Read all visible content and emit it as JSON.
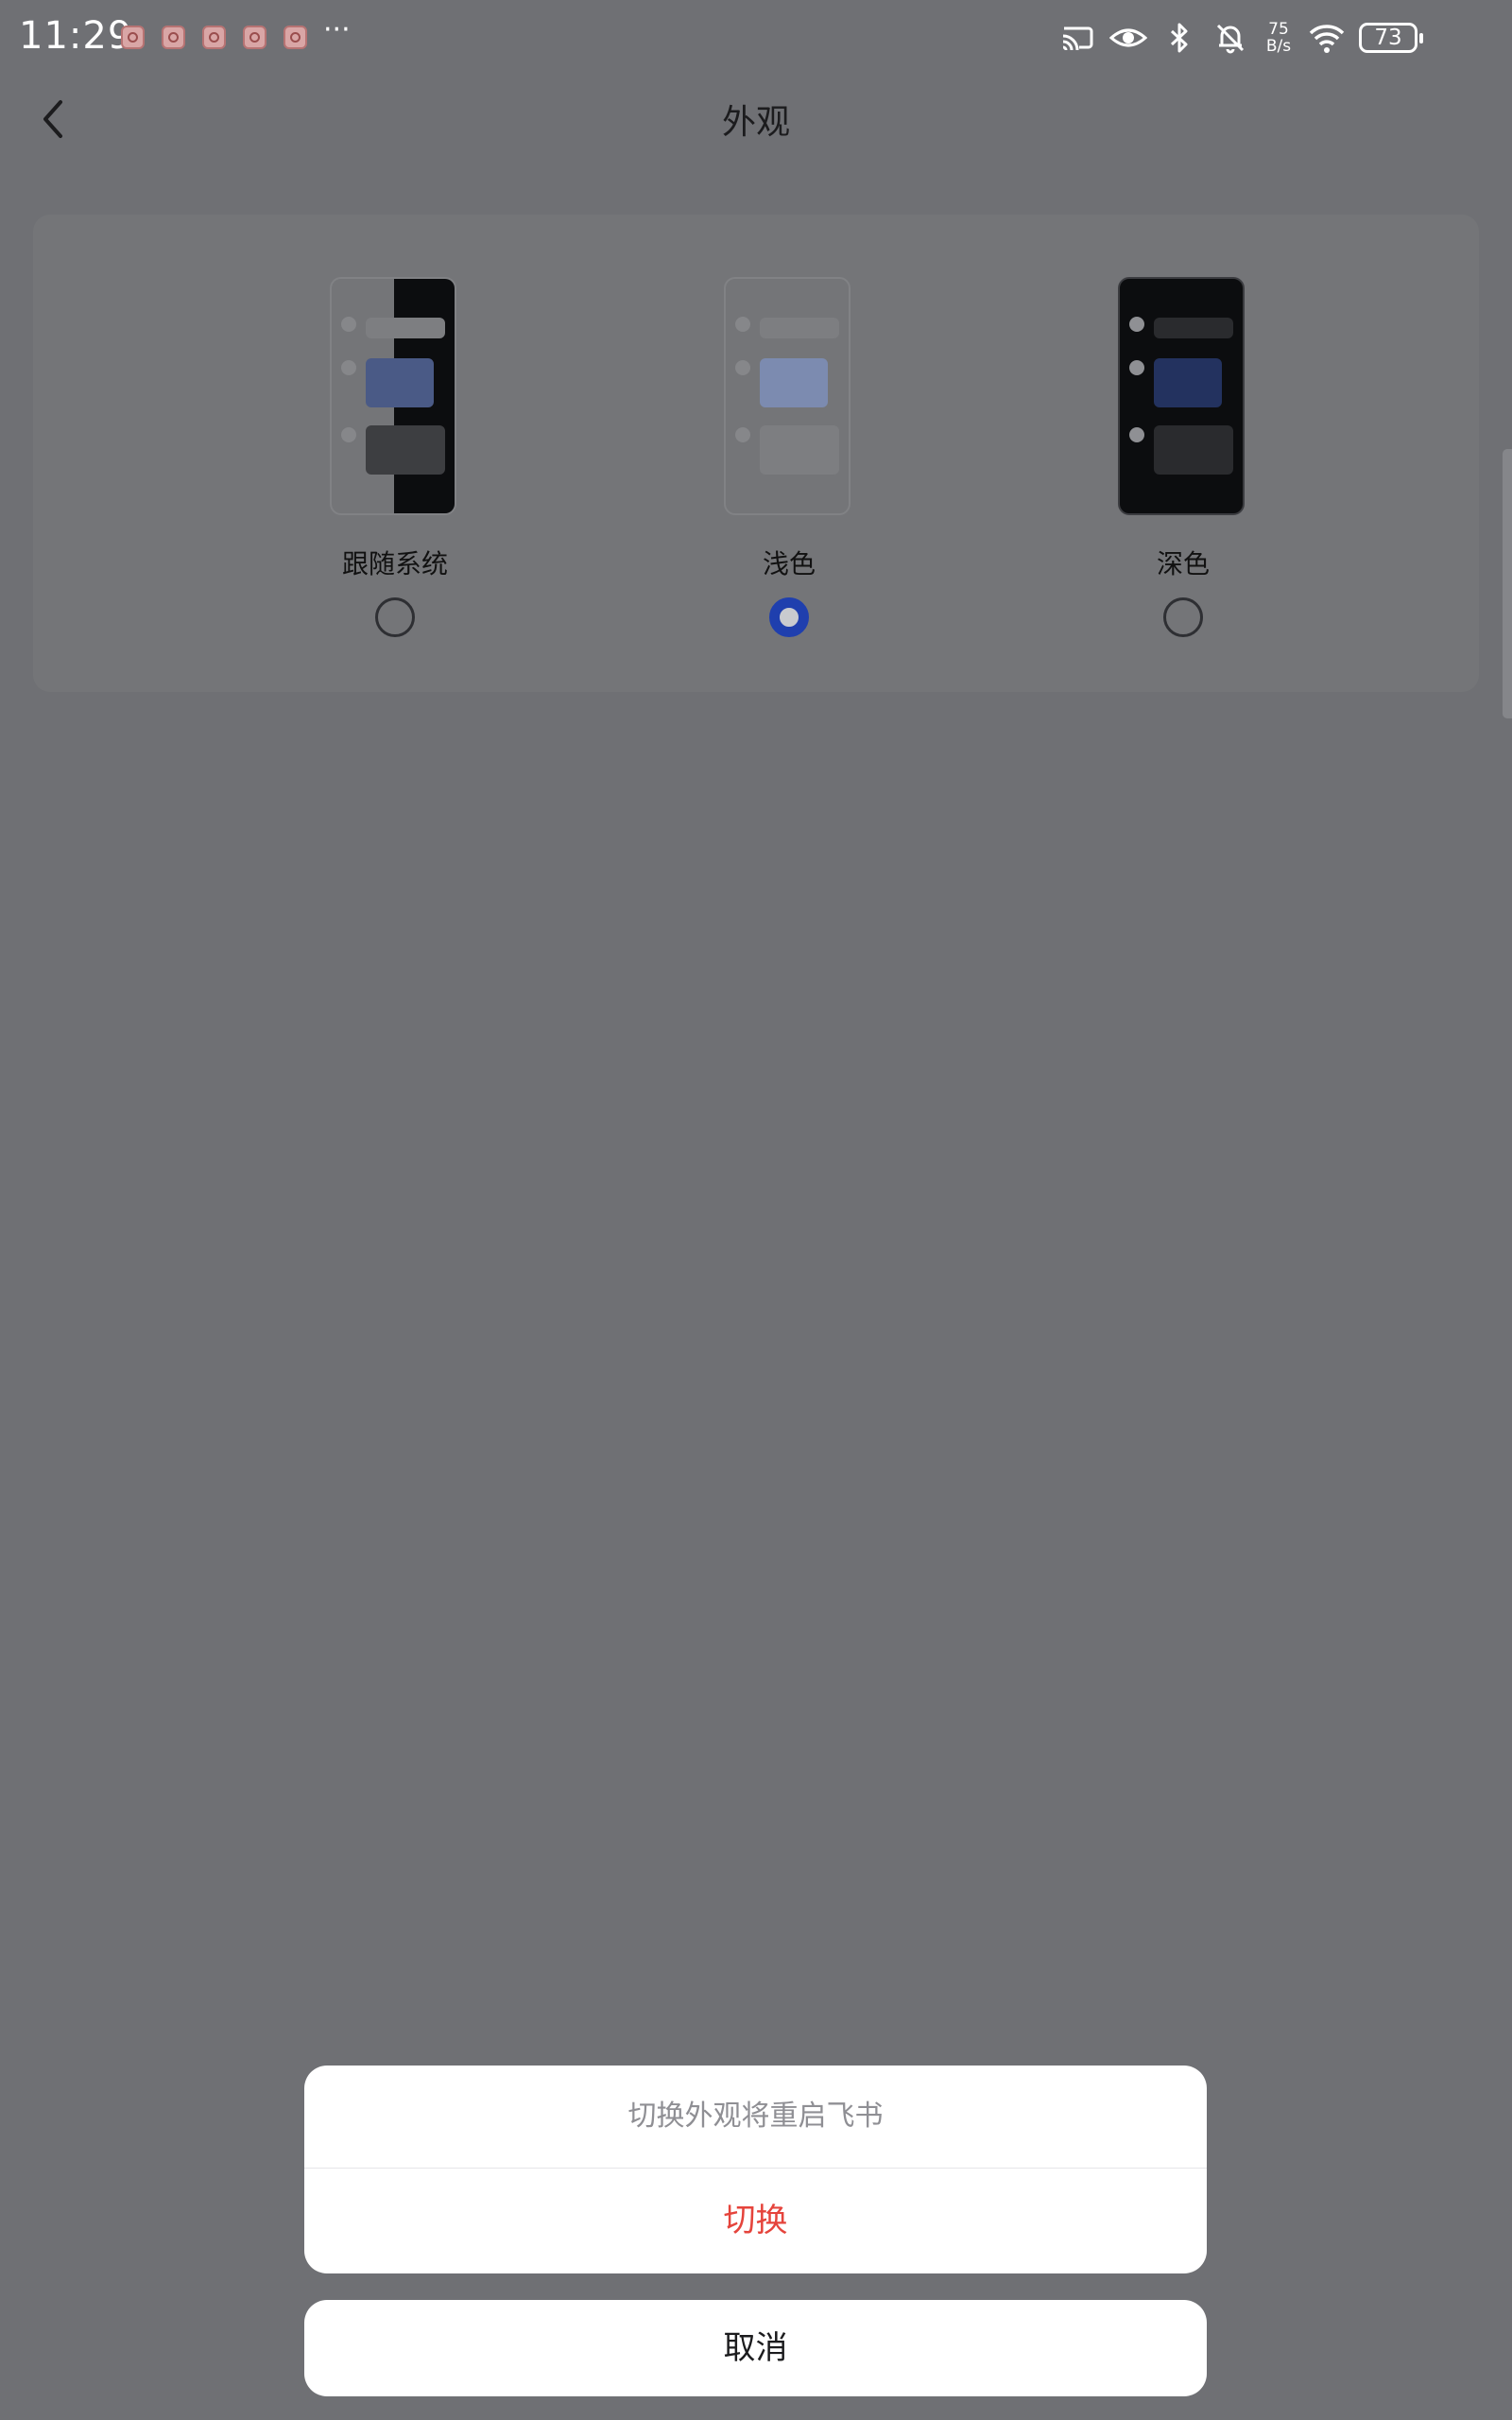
{
  "status_bar": {
    "time": "11:29",
    "more": "···",
    "speed": "75\nB/s",
    "speed_top": "75",
    "speed_bottom": "B/s",
    "battery": "73",
    "icons": [
      "cast-icon",
      "eye-icon",
      "bluetooth-icon",
      "bell-muted-icon",
      "wifi-icon",
      "battery-icon"
    ]
  },
  "header": {
    "title": "外观",
    "back_icon": "chevron-left-icon"
  },
  "theme_options": [
    {
      "label": "跟随系统",
      "selected": false
    },
    {
      "label": "浅色",
      "selected": true
    },
    {
      "label": "深色",
      "selected": false
    }
  ],
  "dialog": {
    "message": "切换外观将重启飞书",
    "confirm_label": "切换",
    "cancel_label": "取消"
  },
  "colors": {
    "overlay": "#6f7074",
    "accent": "#1f3fae",
    "destructive": "#e5443c"
  }
}
